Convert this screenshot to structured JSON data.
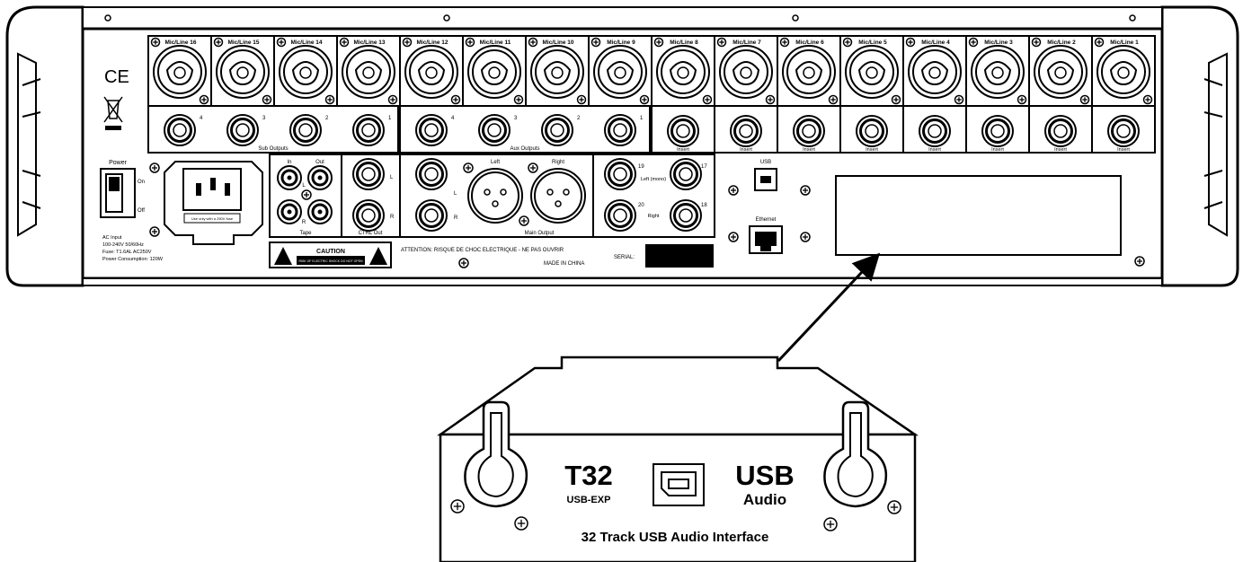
{
  "mixer": {
    "channel_label_prefix": "Mic/Line",
    "channel_numbers": [
      "16",
      "15",
      "14",
      "13",
      "12",
      "11",
      "10",
      "9",
      "8",
      "7",
      "6",
      "5",
      "4",
      "3",
      "2",
      "1"
    ],
    "sub_outputs_label": "Sub Outputs",
    "sub_output_numbers": [
      "4",
      "3",
      "2",
      "1"
    ],
    "aux_outputs_label": "Aux Outputs",
    "aux_output_numbers": [
      "4",
      "3",
      "2",
      "1"
    ],
    "insert_label": "Insert",
    "ce_mark": "CE",
    "power_label": "Power",
    "power_on": "On",
    "power_off": "Off",
    "fuse_note": "Use only with a 250V fuse",
    "ac_input_lines": [
      "AC Input",
      "100-240V 50/60Hz",
      "Fuse: T1.6AL AC250V",
      "Power Consumption: 120W"
    ],
    "tape_label": "Tape",
    "tape_in": "In",
    "tape_out": "Out",
    "left_short": "L",
    "right_short": "R",
    "ctrl_out_label": "CTRL Out",
    "main_left": "Left",
    "main_right": "Right",
    "main_output_label": "Main Output",
    "main_numbers": [
      "19",
      "17",
      "20",
      "18"
    ],
    "left_mono": "Left (mono)",
    "right_label": "Right",
    "caution_title": "CAUTION",
    "caution_text": "RISK OF ELECTRIC SHOCK DO NOT OPEN",
    "attention_text": "ATTENTION: RISQUE DE CHOC ELECTRIQUE - NE PAS OUVRIR",
    "made_in": "MADE IN CHINA",
    "serial_label": "SERIAL:",
    "usb_label": "USB",
    "ethernet_label": "Ethernet"
  },
  "card": {
    "model": "T32",
    "submodel": "USB-EXP",
    "usb_title": "USB",
    "usb_subtitle": "Audio",
    "description": "32 Track USB Audio Interface"
  }
}
